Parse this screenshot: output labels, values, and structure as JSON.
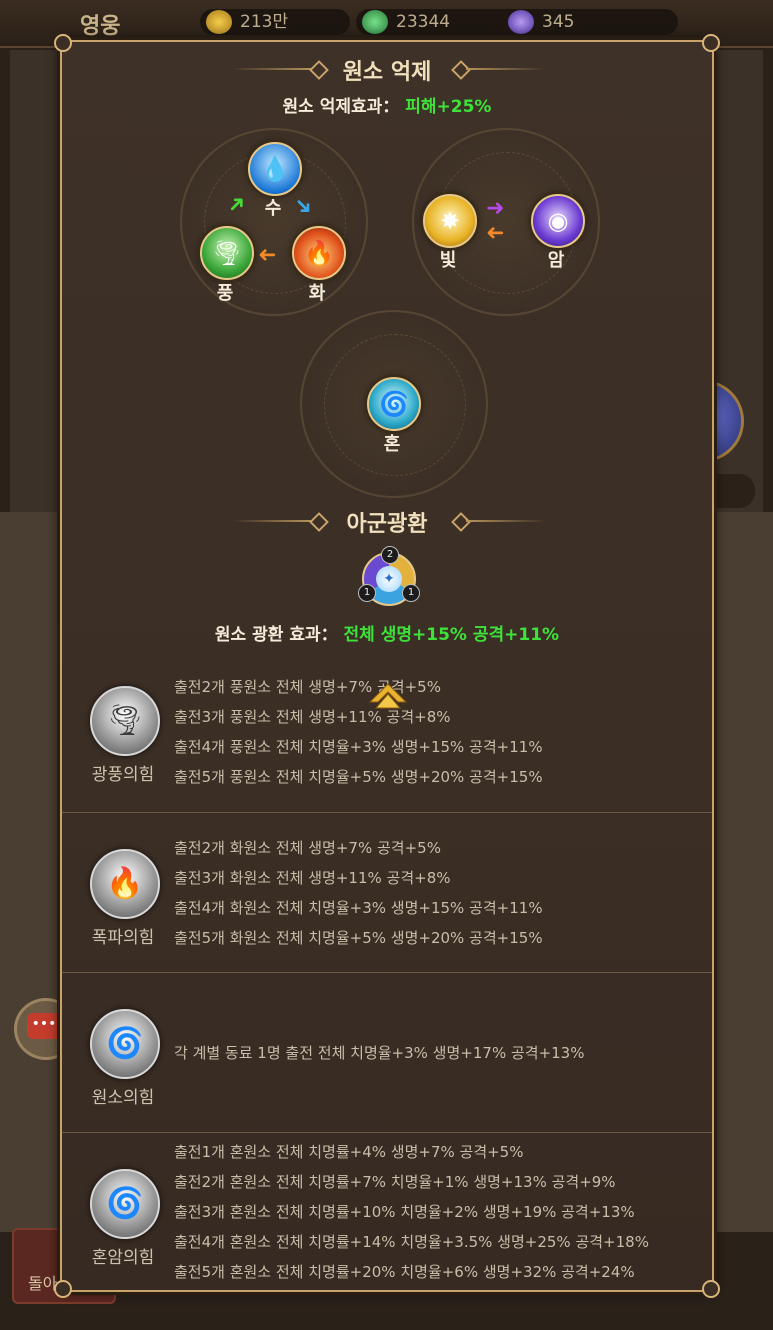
{
  "background": {
    "title": "영웅",
    "resources": [
      {
        "icon": "gold-icon",
        "value": "213만"
      },
      {
        "icon": "green-crystal-icon",
        "value": "23344"
      },
      {
        "icon": "purple-gem-icon",
        "value": "345"
      }
    ]
  },
  "modal": {
    "restraint_title": "원소 억제",
    "restraint_effect_label": "원소 억제효과：",
    "restraint_effect_value": "피해+25%",
    "elements": {
      "water": "수",
      "fire": "화",
      "wind": "풍",
      "light": "빛",
      "dark": "암",
      "chaos": "혼"
    },
    "awaken_title": "아군광환",
    "awaken_badges": {
      "top": "2",
      "left": "1",
      "right": "1"
    },
    "awaken_effect_label": "원소 광환 효과：",
    "awaken_effect_value": "전체 생명+15% 공격+11%",
    "bonuses": [
      {
        "name": "광풍의힘",
        "icon": "wind-icon",
        "lines": [
          "출전2개 풍원소 전체 생명+7% 공격+5%",
          "출전3개 풍원소 전체 생명+11% 공격+8%",
          "출전4개 풍원소 전체 치명율+3% 생명+15% 공격+11%",
          "출전5개 풍원소 전체 치명율+5% 생명+20% 공격+15%"
        ]
      },
      {
        "name": "폭파의힘",
        "icon": "fire-icon",
        "lines": [
          "출전2개 화원소 전체 생명+7% 공격+5%",
          "출전3개 화원소 전체 생명+11% 공격+8%",
          "출전4개 화원소 전체 치명율+3% 생명+15% 공격+11%",
          "출전5개 화원소 전체 치명율+5% 생명+20% 공격+15%"
        ]
      },
      {
        "name": "원소의힘",
        "icon": "element-swirl-icon",
        "lines": [
          "각 계별 동료 1명 출전 전체 치명율+3% 생명+17% 공격+13%"
        ]
      },
      {
        "name": "혼암의힘",
        "icon": "chaos-swirl-icon",
        "lines": [
          "출전1개 혼원소 전체 치명률+4% 생명+7% 공격+5%",
          "출전2개 혼원소 전체 치명률+7% 치명율+1% 생명+13% 공격+9%",
          "출전3개 혼원소 전체 치명률+10% 치명율+2% 생명+19% 공격+13%",
          "출전4개 혼원소 전체 치명률+14% 치명율+3.5% 생명+25% 공격+18%",
          "출전5개 혼원소 전체 치명률+20% 치명율+6% 생명+32% 공격+24%"
        ]
      }
    ]
  },
  "colors": {
    "accent_green": "#3ee23a",
    "border_gold": "#c9a36a",
    "panel_brown": "#3a2e25"
  }
}
